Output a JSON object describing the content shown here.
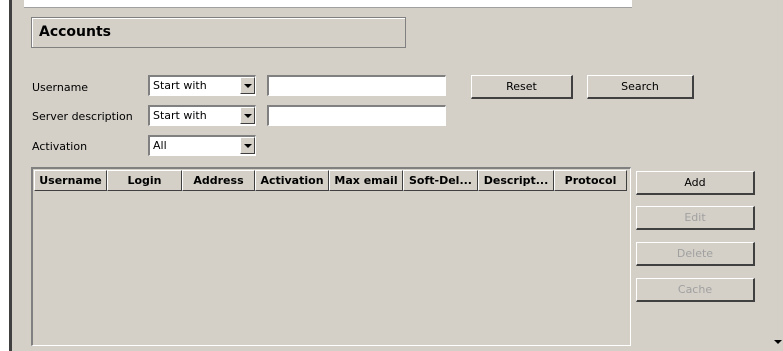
{
  "section": {
    "title": "Accounts"
  },
  "filters": {
    "username": {
      "label": "Username",
      "mode": "Start with",
      "value": ""
    },
    "server_description": {
      "label": "Server description",
      "mode": "Start with",
      "value": ""
    },
    "activation": {
      "label": "Activation",
      "value": "All"
    }
  },
  "buttons": {
    "reset": "Reset",
    "search": "Search",
    "add": "Add",
    "edit": "Edit",
    "delete": "Delete",
    "cache": "Cache"
  },
  "table": {
    "columns": [
      "Username",
      "Login",
      "Address",
      "Activation",
      "Max email",
      "Soft-Del...",
      "Descript...",
      "Protocol"
    ],
    "rows": []
  },
  "icons": {
    "dropdown": "chevron-down-icon",
    "scroll_down": "scroll-down-arrow-icon"
  }
}
